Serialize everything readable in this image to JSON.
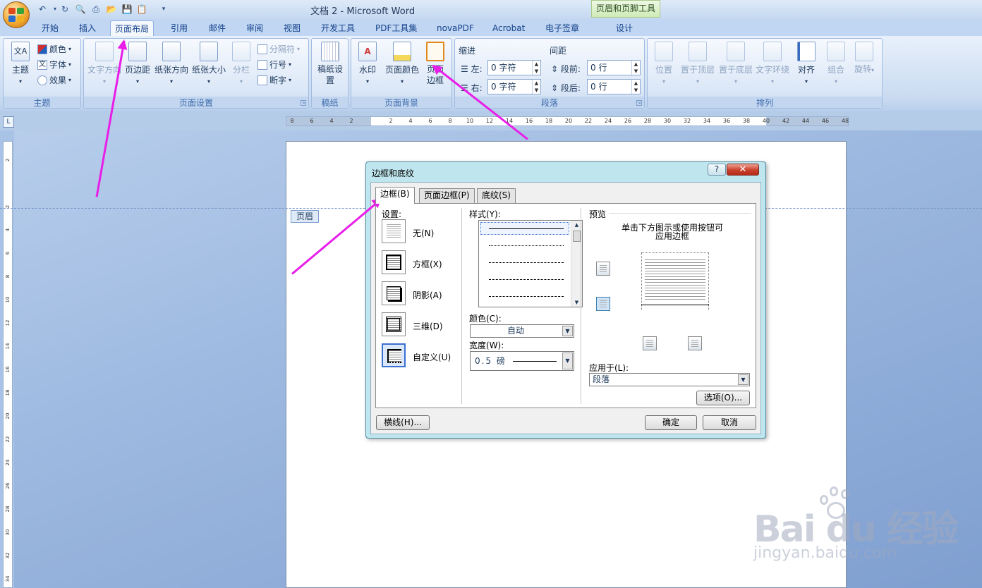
{
  "app": {
    "title": "文档 2 - Microsoft Word",
    "context_group": "页眉和页脚工具"
  },
  "tabs": [
    "开始",
    "插入",
    "页面布局",
    "引用",
    "邮件",
    "审阅",
    "视图",
    "开发工具",
    "PDF工具集",
    "novaPDF",
    "Acrobat",
    "电子签章",
    "设计"
  ],
  "active_tab": "页面布局",
  "ribbon": {
    "theme": {
      "label": "主题",
      "btn": "主题",
      "colors": "颜色",
      "fonts": "字体",
      "effects": "效果"
    },
    "page_setup": {
      "label": "页面设置",
      "text_direction": "文字方向",
      "margins": "页边距",
      "orientation": "纸张方向",
      "size": "纸张大小",
      "columns": "分栏",
      "breaks": "分隔符",
      "line_numbers": "行号",
      "hyphenation": "断字"
    },
    "manuscript": {
      "label": "稿纸",
      "btn": "稿纸设置"
    },
    "page_background": {
      "label": "页面背景",
      "watermark": "水印",
      "page_color": "页面颜色",
      "page_borders": "页面边框"
    },
    "paragraph": {
      "label": "段落",
      "indent": "缩进",
      "left": "左:",
      "right": "右:",
      "left_val": "0 字符",
      "right_val": "0 字符",
      "spacing": "间距",
      "before": "段前:",
      "after": "段后:",
      "before_val": "0 行",
      "after_val": "0 行"
    },
    "arrange": {
      "label": "排列",
      "position": "位置",
      "bring_front": "置于顶层",
      "send_back": "置于底层",
      "text_wrap": "文字环绕",
      "align": "对齐",
      "group": "组合",
      "rotate": "旋转"
    }
  },
  "ruler_numbers": [
    "8",
    "6",
    "4",
    "2",
    "",
    "2",
    "4",
    "6",
    "8",
    "10",
    "12",
    "14",
    "16",
    "18",
    "20",
    "22",
    "24",
    "26",
    "28",
    "30",
    "32",
    "34",
    "36",
    "38",
    "40",
    "42",
    "44",
    "46",
    "48"
  ],
  "vruler_numbers": [
    "2",
    "",
    "2",
    "4",
    "6",
    "8",
    "10",
    "12",
    "14",
    "16",
    "18",
    "20",
    "22",
    "24",
    "26",
    "28",
    "30",
    "32",
    "34"
  ],
  "document": {
    "header_tag": "页眉"
  },
  "dialog": {
    "title": "边框和底纹",
    "tabs": [
      "边框(B)",
      "页面边框(P)",
      "底纹(S)"
    ],
    "settings_label": "设置:",
    "settings": [
      "无(N)",
      "方框(X)",
      "阴影(A)",
      "三维(D)",
      "自定义(U)"
    ],
    "style_label": "样式(Y):",
    "color_label": "颜色(C):",
    "color_value": "自动",
    "width_label": "宽度(W):",
    "width_value": "0.5 磅",
    "preview_label": "预览",
    "preview_hint_1": "单击下方图示或使用按钮可",
    "preview_hint_2": "应用边框",
    "apply_label": "应用于(L):",
    "apply_value": "段落",
    "options_btn": "选项(O)...",
    "hline_btn": "横线(H)...",
    "ok_btn": "确定",
    "cancel_btn": "取消"
  },
  "watermark": {
    "brand": "Bai du 经验",
    "url": "jingyan.baidu.com"
  }
}
